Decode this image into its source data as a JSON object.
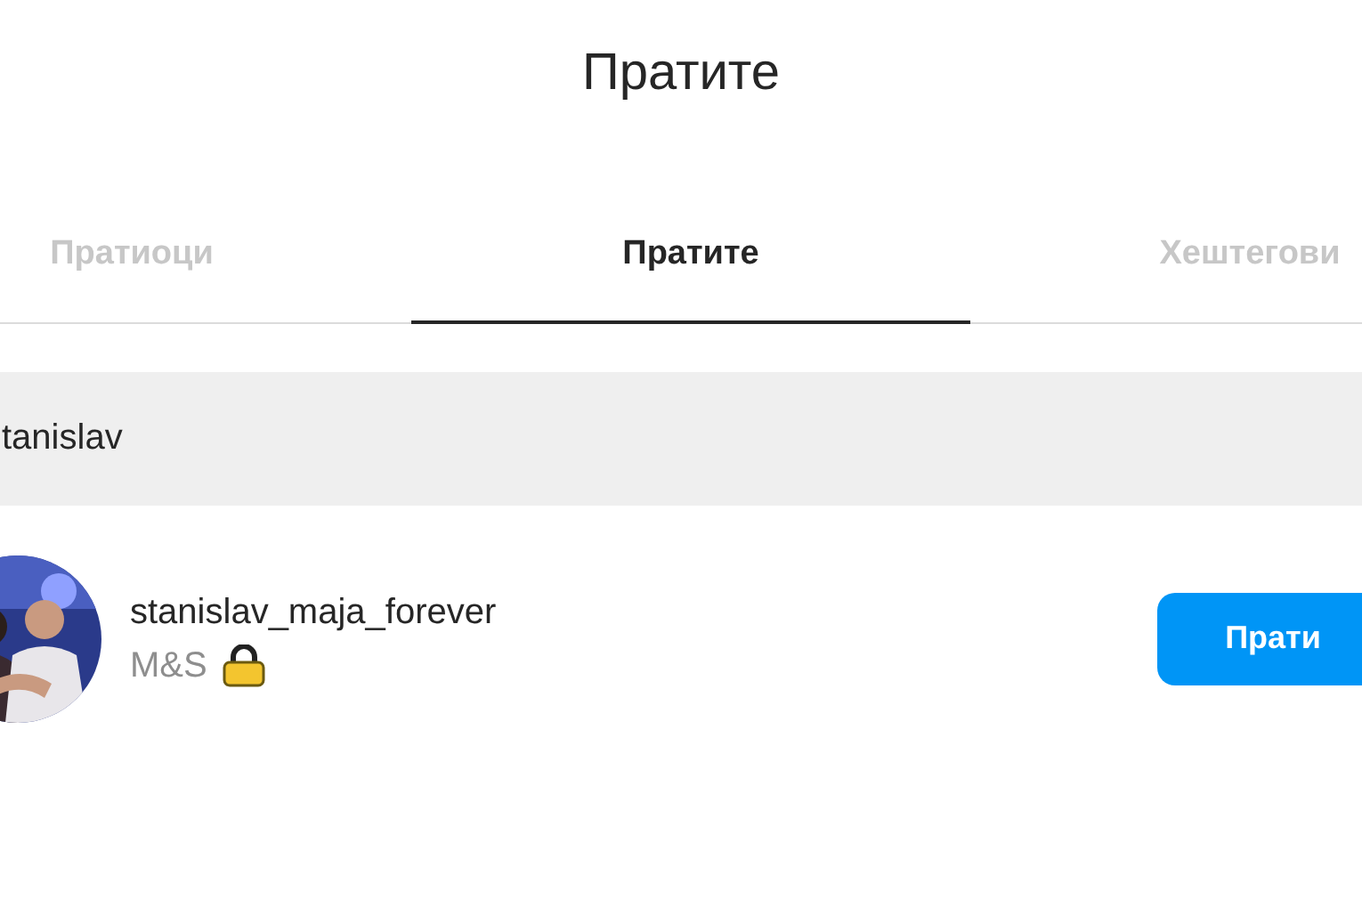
{
  "title": "Пратите",
  "tabs": [
    {
      "label": "Пратиоци",
      "selected": false
    },
    {
      "label": "Пратите",
      "selected": true
    },
    {
      "label": "Хештегови",
      "selected": false
    }
  ],
  "search": {
    "value": "tanislav"
  },
  "results": [
    {
      "username": "stanislav_maja_forever",
      "full_name": "M&S",
      "button": "Прати"
    }
  ]
}
